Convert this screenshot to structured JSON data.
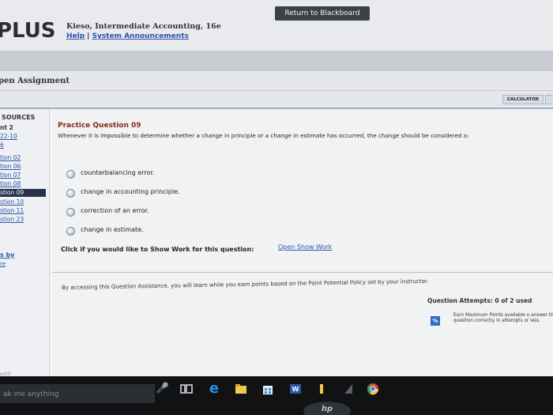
{
  "header": {
    "return_label": "Return to Blackboard",
    "logo": "PLUS",
    "book_title": "Kieso, Intermediate Accounting, 16e",
    "help_label": "Help",
    "announcements_label": "System Announcements",
    "separator": "|"
  },
  "assignment": {
    "title": "pen Assignment",
    "calculator_label": "CALCULATOR"
  },
  "sidebar": {
    "resources_label": "SOURCES",
    "items": [
      {
        "label": "nt 2"
      },
      {
        "label": "22-10"
      },
      {
        "label": "6"
      },
      {
        "label": "tion 02"
      },
      {
        "label": "tion 06"
      },
      {
        "label": "tion 07"
      },
      {
        "label": "tion 08"
      },
      {
        "label": "stion 09"
      },
      {
        "label": "stion 10"
      },
      {
        "label": "stion 11"
      },
      {
        "label": "stion 23"
      }
    ],
    "bottom_link": "s by",
    "bottom_link2": "re"
  },
  "question": {
    "title": "Practice Question 09",
    "text": "Whenever it is impossible to determine whether a change in principle or a change in estimate has occurred, the change should be considered a:",
    "options": [
      {
        "label": "counterbalancing error."
      },
      {
        "label": "change in accounting principle."
      },
      {
        "label": "correction of an error."
      },
      {
        "label": "change in estimate."
      }
    ],
    "show_work_prompt": "Click if you would like to Show Work for this question:",
    "show_work_link": "Open Show Work"
  },
  "assistance": {
    "text": "By accessing this Question Assistance, you will learn while you earn points based on the Point Potential Policy set by your instructor.",
    "attempts_label": "Question Attempts: 0 of 2 used",
    "pct_icon": "%",
    "earn_text": "Earn Maximum Points available o answer this question correctly in attempts or less."
  },
  "taskbar": {
    "search_placeholder": "ak me anything",
    "corner_text": "ext0",
    "brand": "hp",
    "icons": [
      "microphone-icon",
      "task-view-icon",
      "edge-browser-icon",
      "file-explorer-icon",
      "store-icon",
      "word-icon",
      "pin-icon",
      "hp-app-icon",
      "chrome-icon"
    ]
  },
  "colors": {
    "accent_link": "#2a54a8",
    "question_title": "#8a2a1a",
    "selected_nav": "#26324a",
    "return_button": "#3c4148"
  }
}
